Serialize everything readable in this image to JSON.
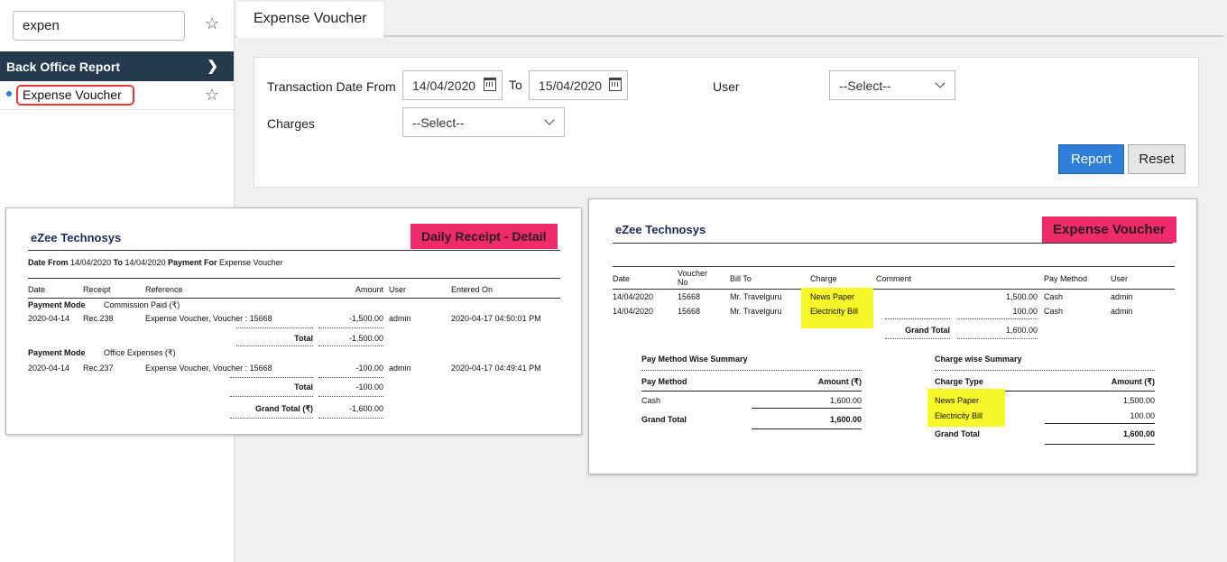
{
  "sidebar": {
    "search_value": "expen",
    "menu_header": "Back Office Report",
    "menu_item": "Expense Voucher"
  },
  "tab": {
    "title": "Expense Voucher"
  },
  "filters": {
    "date_from_label": "Transaction Date From",
    "date_from": "14/04/2020",
    "to_label": "To",
    "date_to": "15/04/2020",
    "user_label": "User",
    "user_select": "--Select--",
    "charges_label": "Charges",
    "charges_select": "--Select--",
    "report_btn": "Report",
    "reset_btn": "Reset"
  },
  "report1": {
    "company": "eZee Technosys",
    "tag": "Daily Receipt - Detail",
    "subtitle_a": "Date From",
    "subtitle_b": "14/04/2020",
    "subtitle_c": "To",
    "subtitle_d": "14/04/2020",
    "subtitle_e": "Payment For",
    "subtitle_f": "Expense Voucher",
    "headers": [
      "Date",
      "Receipt",
      "Reference",
      "Amount",
      "User",
      "Entered On"
    ],
    "groups": [
      {
        "mode_label": "Payment Mode",
        "mode_value": "Commission Paid (₹)",
        "row": [
          "2020-04-14",
          "Rec.238",
          "Expense Voucher, Voucher : 15668",
          "-1,500.00",
          "admin",
          "2020-04-17 04:50:01 PM"
        ],
        "total_label": "Total",
        "total": "-1,500.00"
      },
      {
        "mode_label": "Payment Mode",
        "mode_value": "Office Expenses (₹)",
        "row": [
          "2020-04-14",
          "Rec.237",
          "Expense Voucher, Voucher : 15668",
          "-100.00",
          "admin",
          "2020-04-17 04:49:41 PM"
        ],
        "total_label": "Total",
        "total": "-100.00"
      }
    ],
    "grand_total_label": "Grand Total (₹)",
    "grand_total": "-1,600.00"
  },
  "report2": {
    "company": "eZee Technosys",
    "tag": "Expense Voucher",
    "headers": [
      "Date",
      "Voucher No",
      "Bill To",
      "Charge",
      "Comment",
      "Pay Method",
      "User"
    ],
    "rows": [
      [
        "14/04/2020",
        "15668",
        "Mr. Travelguru",
        "News Paper",
        "1,500.00",
        "Cash",
        "admin"
      ],
      [
        "14/04/2020",
        "15668",
        "Mr. Travelguru",
        "Electricity Bill",
        "100.00",
        "Cash",
        "admin"
      ]
    ],
    "grand_total_label": "Grand Total",
    "grand_total": "1,600.00",
    "pay_summary": {
      "title": "Pay Method Wise Summary",
      "col1": "Pay Method",
      "col2": "Amount (₹)",
      "row": [
        "Cash",
        "1,600.00"
      ],
      "total_label": "Grand Total",
      "total": "1,600.00"
    },
    "charge_summary": {
      "title": "Charge wise Summary",
      "col1": "Charge Type",
      "col2": "Amount (₹)",
      "rows": [
        [
          "News Paper",
          "1,500.00"
        ],
        [
          "Electricity Bill",
          "100.00"
        ]
      ],
      "total_label": "Grand Total",
      "total": "1,600.00"
    }
  }
}
